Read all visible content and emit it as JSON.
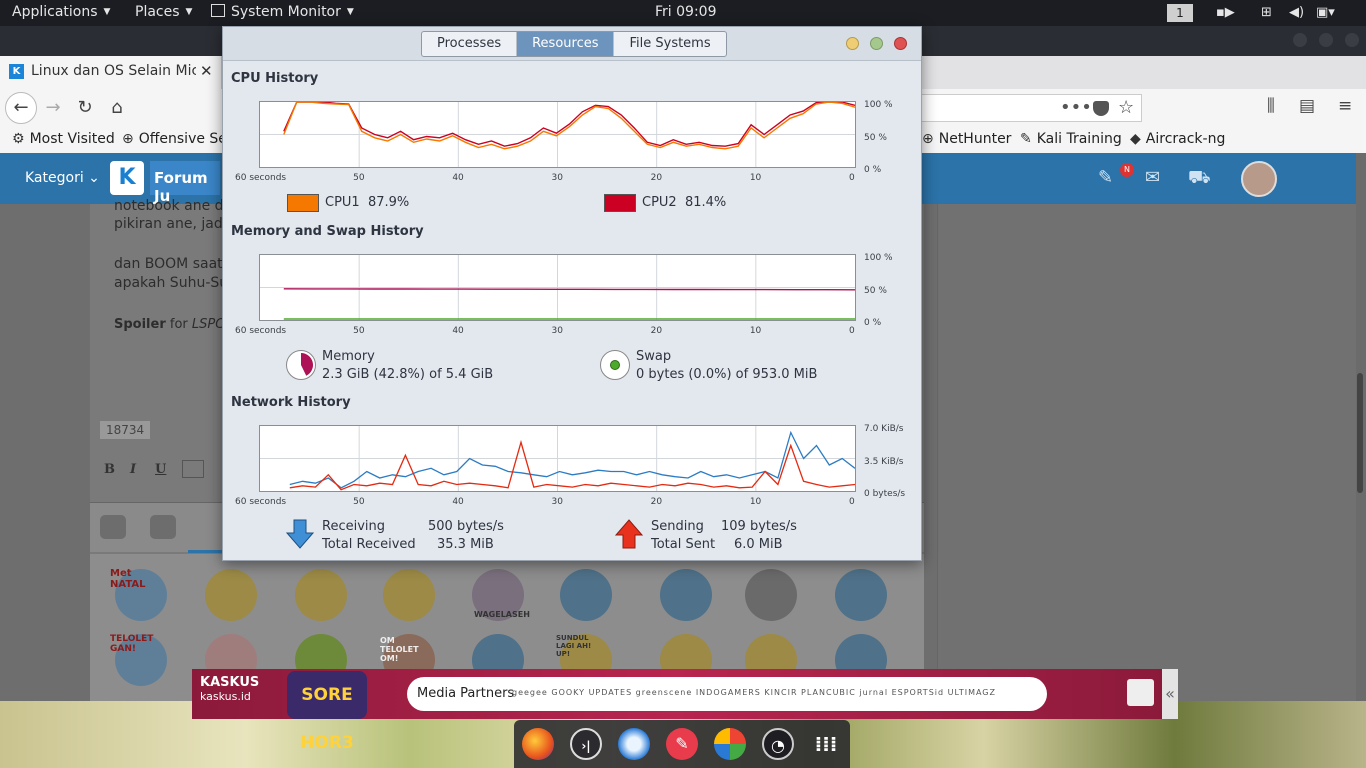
{
  "topbar": {
    "applications": "Applications",
    "places": "Places",
    "system_monitor": "System Monitor",
    "clock": "Fri 09:09",
    "workspace": "1"
  },
  "browser": {
    "tab_title": "Linux dan OS Selain Micro",
    "tab_favicon": "K",
    "bookmarks": [
      {
        "label": "Most Visited",
        "icon": "gear-icon"
      },
      {
        "label": "Offensive Se",
        "icon": "globe-icon"
      },
      {
        "label": "NetHunter",
        "icon": "globe-icon"
      },
      {
        "label": "Kali Training",
        "icon": "kali-icon"
      },
      {
        "label": "Aircrack-ng",
        "icon": "aircrack-icon"
      }
    ]
  },
  "kaskus": {
    "kategori": "Kategori",
    "logo": "K",
    "forum": "Forum Ju",
    "notif_badge": "N",
    "post_lines": [
      "notebook ane dua",
      "pikiran ane, jadi a",
      "dan BOOM saat s",
      "apakah Suhu-Suh"
    ],
    "spoiler_label": "Spoiler",
    "spoiler_for": "for",
    "spoiler_title": "LSPCI:",
    "char_count": "18734",
    "fmt_bold": "B",
    "fmt_italic": "I",
    "fmt_underline": "U",
    "emoji_label_1": "Met NATAL",
    "emoji_label_2": "TELOLET GAN!",
    "emoji_label_3": "WAGELASEH",
    "emoji_label_4": "OM TELOLET OM!",
    "emoji_label_5": "SUNDUL LAGI AH! UP!"
  },
  "ad": {
    "brand": "KASKUS",
    "domain": "kaskus.id",
    "show": "SORE HOR3",
    "media_partners": "Media Partners",
    "partners": "geegee  GOOKY UPDATES  greenscene  INDOGAMERS  KINCIR  PLANCUBIC  jurnal  ESPORTSid  ULTIMAGZ"
  },
  "sysmon": {
    "tabs": [
      "Processes",
      "Resources",
      "File Systems"
    ],
    "active_tab": "Resources",
    "cpu": {
      "title": "CPU History",
      "cpu1_label": "CPU1",
      "cpu1_value": "87.9%",
      "cpu1_color": "#f57900",
      "cpu2_label": "CPU2",
      "cpu2_value": "81.4%",
      "cpu2_color": "#cc0022"
    },
    "memory": {
      "title": "Memory and Swap History",
      "mem_label": "Memory",
      "mem_value": "2.3 GiB (42.8%) of 5.4 GiB",
      "mem_color": "#ad1257",
      "swap_label": "Swap",
      "swap_value": "0 bytes (0.0%) of 953.0 MiB",
      "swap_color": "#4eaa2a"
    },
    "network": {
      "title": "Network History",
      "recv_label": "Receiving",
      "recv_value": "500 bytes/s",
      "total_recv_label": "Total Received",
      "total_recv_value": "35.3 MiB",
      "send_label": "Sending",
      "send_value": "109 bytes/s",
      "total_sent_label": "Total Sent",
      "total_sent_value": "6.0 MiB",
      "recv_color": "#2c7cc4",
      "send_color": "#e32b12"
    },
    "x_ticks": [
      "60 seconds",
      "50",
      "40",
      "30",
      "20",
      "10",
      "0"
    ],
    "pct_ticks": [
      "100 %",
      "50 %",
      "0 %"
    ],
    "net_ticks": [
      "7.0 KiB/s",
      "3.5 KiB/s",
      "0 bytes/s"
    ]
  }
}
